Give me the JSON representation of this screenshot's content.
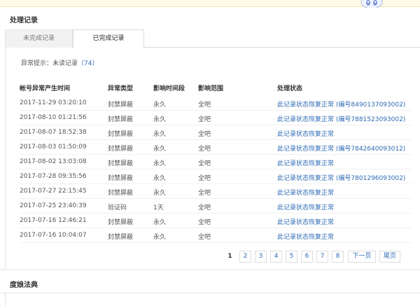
{
  "section_title": "处理记录",
  "tabs": [
    {
      "label": "未完成记录",
      "active": false
    },
    {
      "label": "已完成记录",
      "active": true
    }
  ],
  "hint": {
    "label": "异常提示：未读记录",
    "count": "（74）"
  },
  "columns": [
    "帐号异常产生时间",
    "异常类型",
    "影响时间段",
    "影响范围",
    "处理状态"
  ],
  "rows": [
    {
      "time": "2017-11-29 03:20:10",
      "type": "封禁屏蔽",
      "duration": "永久",
      "scope": "全吧",
      "status": "此记录状态恢复正常 (编号8490137093002)"
    },
    {
      "time": "2017-08-10 01:21:56",
      "type": "封禁屏蔽",
      "duration": "永久",
      "scope": "全吧",
      "status": "此记录状态恢复正常 (编号7881523093002)"
    },
    {
      "time": "2017-08-07 18:52:38",
      "type": "封禁屏蔽",
      "duration": "永久",
      "scope": "全吧",
      "status": "此记录状态恢复正常"
    },
    {
      "time": "2017-08-03 01:50:09",
      "type": "封禁屏蔽",
      "duration": "永久",
      "scope": "全吧",
      "status": "此记录状态恢复正常 (编号7842640093012)"
    },
    {
      "time": "2017-08-02 13:03:08",
      "type": "封禁屏蔽",
      "duration": "永久",
      "scope": "全吧",
      "status": "此记录状态恢复正常"
    },
    {
      "time": "2017-07-28 09:35:56",
      "type": "封禁屏蔽",
      "duration": "永久",
      "scope": "全吧",
      "status": "此记录状态恢复正常 (编号7801296093002)"
    },
    {
      "time": "2017-07-27 22:15:45",
      "type": "封禁屏蔽",
      "duration": "永久",
      "scope": "全吧",
      "status": "此记录状态恢复正常"
    },
    {
      "time": "2017-07-25 23:40:39",
      "type": "验证码",
      "duration": "1天",
      "scope": "全吧",
      "status": "此记录状态恢复正常"
    },
    {
      "time": "2017-07-16 12:46:21",
      "type": "封禁屏蔽",
      "duration": "永久",
      "scope": "全吧",
      "status": "此记录状态恢复正常"
    },
    {
      "time": "2017-07-16 10:04:07",
      "type": "封禁屏蔽",
      "duration": "永久",
      "scope": "全吧",
      "status": "此记录状态恢复正常"
    }
  ],
  "pagination": {
    "pages": [
      "1",
      "2",
      "3",
      "4",
      "5",
      "6",
      "7",
      "8"
    ],
    "current": "1",
    "next": "下一页",
    "last": "尾页"
  },
  "footer_section_title": "度娘法典",
  "icons": {
    "mascot": "mascot-icon"
  }
}
